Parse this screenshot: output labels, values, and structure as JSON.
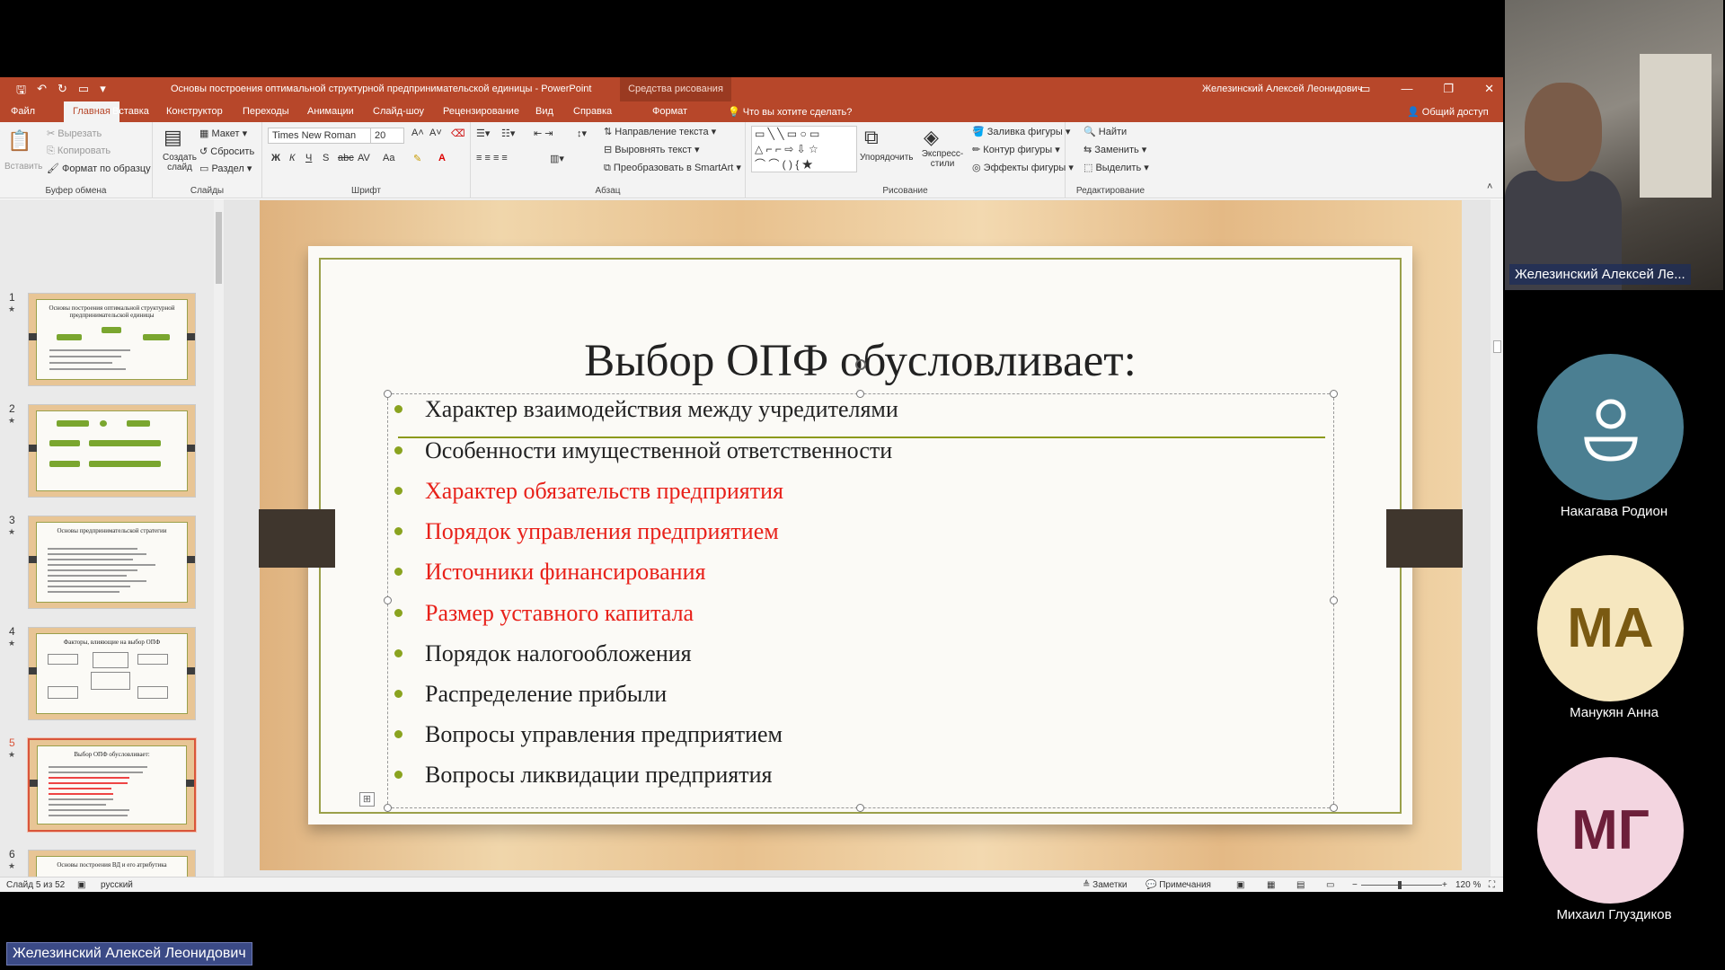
{
  "window": {
    "title": "Основы построения оптимальной структурной предпринимательской единицы  -  PowerPoint",
    "context_tools": "Средства рисования",
    "user": "Железинский Алексей Леонидович"
  },
  "tabs": [
    "Файл",
    "Главная",
    "Вставка",
    "Конструктор",
    "Переходы",
    "Анимации",
    "Слайд-шоу",
    "Рецензирование",
    "Вид",
    "Справка",
    "Формат"
  ],
  "tell_me": "Что вы хотите сделать?",
  "share": "Общий доступ",
  "ribbon": {
    "clipboard": {
      "paste": "Вставить",
      "cut": "Вырезать",
      "copy": "Копировать",
      "format_painter": "Формат по образцу",
      "label": "Буфер обмена"
    },
    "slides": {
      "new_slide": "Создать слайд",
      "layout": "Макет",
      "reset": "Сбросить",
      "section": "Раздел",
      "label": "Слайды"
    },
    "font": {
      "name": "Times New Roman",
      "size": "20",
      "bold": "Ж",
      "italic": "К",
      "underline": "Ч",
      "shadow": "S",
      "strike": "abc",
      "spacing": "AV",
      "case": "Aa",
      "label": "Шрифт"
    },
    "paragraph": {
      "text_direction": "Направление текста",
      "align_text": "Выровнять текст",
      "convert_smartart": "Преобразовать в SmartArt",
      "label": "Абзац"
    },
    "drawing": {
      "arrange": "Упорядочить",
      "quick_styles": "Экспресс-стили",
      "fill": "Заливка фигуры",
      "outline": "Контур фигуры",
      "effects": "Эффекты фигуры",
      "label": "Рисование"
    },
    "editing": {
      "find": "Найти",
      "replace": "Заменить",
      "select": "Выделить",
      "label": "Редактирование"
    }
  },
  "thumbnails": [
    {
      "num": "1",
      "title": "Основы построения оптимальной структурной предпринимательской единицы"
    },
    {
      "num": "2",
      "title": ""
    },
    {
      "num": "3",
      "title": "Основы предпринимательской стратегии"
    },
    {
      "num": "4",
      "title": "Факторы, влияющие на выбор ОПФ"
    },
    {
      "num": "5",
      "title": "Выбор ОПФ обусловливает:"
    },
    {
      "num": "6",
      "title": "Основы построения ВД и его атрибутика"
    }
  ],
  "slide": {
    "title": "Выбор ОПФ обусловливает:",
    "bullets": [
      {
        "text": "Характер взаимодействия между учредителями",
        "color": "#222222"
      },
      {
        "text": "Особенности имущественной ответственности",
        "color": "#222222"
      },
      {
        "text": "Характер обязательств предприятия",
        "color": "#e8211a"
      },
      {
        "text": "Порядок управления предприятием",
        "color": "#e8211a"
      },
      {
        "text": "Источники финансирования",
        "color": "#e8211a"
      },
      {
        "text": "Размер уставного капитала",
        "color": "#e8211a"
      },
      {
        "text": "Порядок налогообложения",
        "color": "#222222"
      },
      {
        "text": "Распределение прибыли",
        "color": "#222222"
      },
      {
        "text": "Вопросы управления предприятием",
        "color": "#222222"
      },
      {
        "text": "Вопросы ликвидации предприятия",
        "color": "#222222"
      }
    ]
  },
  "status": {
    "slide_counter": "Слайд 5 из 52",
    "language": "русский",
    "notes": "Заметки",
    "comments": "Примечания",
    "zoom": "120 %"
  },
  "meeting": {
    "camera_name": "Железинский Алексей Ле...",
    "participants": [
      {
        "initials": "",
        "name": "Накагава Родион",
        "bg": "#4b7f92",
        "fg": "#ffffff"
      },
      {
        "initials": "МА",
        "name": "Манукян Анна",
        "bg": "#f6e7bf",
        "fg": "#7a5a12"
      },
      {
        "initials": "МГ",
        "name": "Михаил Глуздиков",
        "bg": "#f3d5e0",
        "fg": "#6d1f3a"
      }
    ],
    "presenter": "Железинский Алексей Леонидович"
  }
}
